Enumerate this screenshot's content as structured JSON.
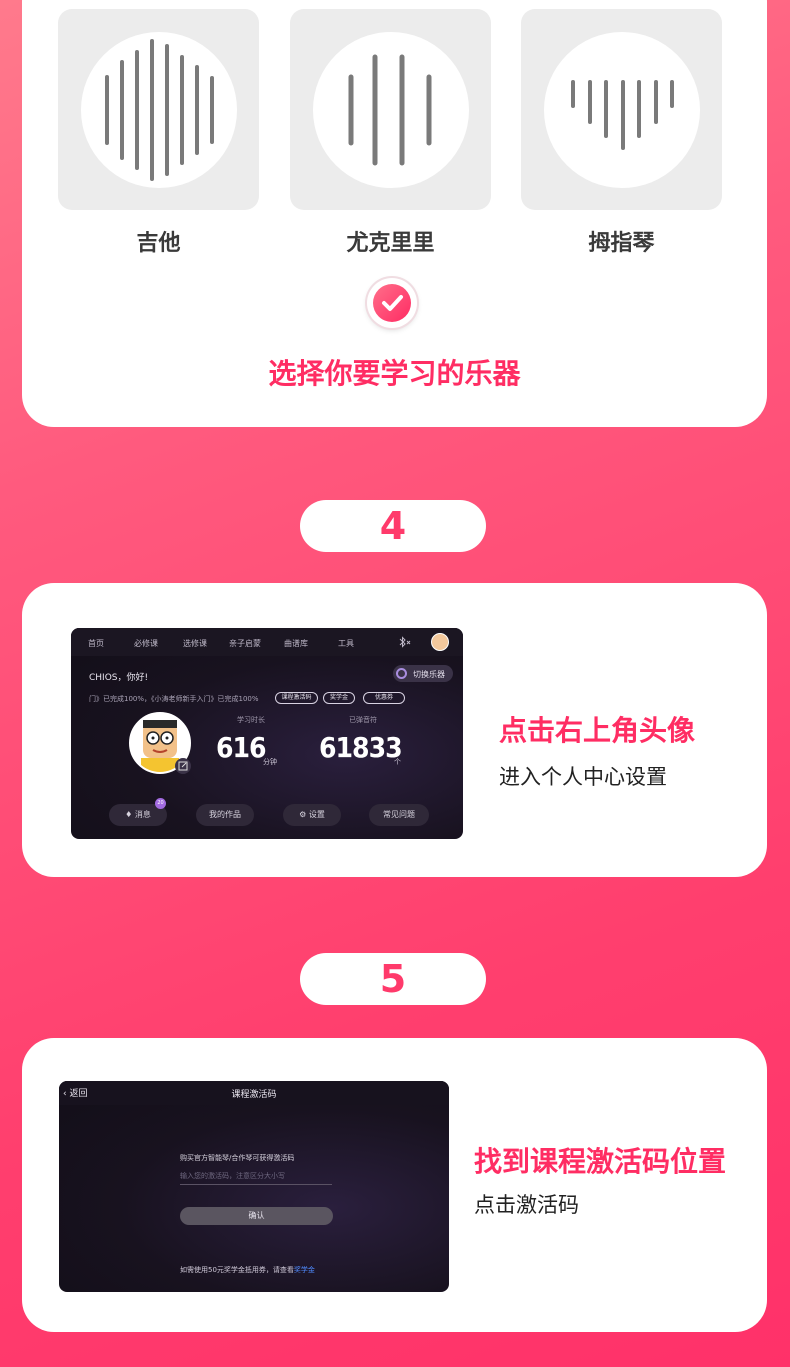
{
  "colors": {
    "accent": "#ff2d63",
    "card": "#ffffff",
    "screen_bg": "#18121f"
  },
  "instruments": [
    {
      "name": "吉他",
      "icon": "waveform-icon"
    },
    {
      "name": "尤克里里",
      "icon": "waveform-icon"
    },
    {
      "name": "拇指琴",
      "icon": "waveform-icon"
    }
  ],
  "step3": {
    "title": "选择你要学习的乐器"
  },
  "step4": {
    "number": "4",
    "title": "点击右上角头像",
    "subtitle": "进入个人中心设置",
    "screen": {
      "nav": [
        "首页",
        "必修课",
        "选修课",
        "亲子启蒙",
        "曲谱库",
        "工具"
      ],
      "greeting": "CHIOS，你好!",
      "switch_label": "切换乐器",
      "progress": "门》已完成100%，《小涛老师新手入门》已完成100%",
      "tags": [
        "课程激活码",
        "奖学金",
        "优惠券"
      ],
      "stat1_label": "学习时长",
      "stat1_value": "616",
      "stat1_unit": "分钟",
      "stat2_label": "已弹音符",
      "stat2_value": "61833",
      "stat2_unit": "个",
      "buttons": [
        "消息",
        "我的作品",
        "设置",
        "常见问题"
      ],
      "badge": "20"
    }
  },
  "step5": {
    "number": "5",
    "title": "找到课程激活码位置",
    "subtitle": "点击激活码",
    "screen": {
      "back": "返回",
      "header": "课程激活码",
      "hint": "购买官方智能琴/合作琴可获得激活码",
      "placeholder": "输入您的激活码，注意区分大小写",
      "confirm": "确认",
      "footer": "如需使用50元奖学金抵用券，请查看",
      "footer_link": "奖学金"
    }
  }
}
